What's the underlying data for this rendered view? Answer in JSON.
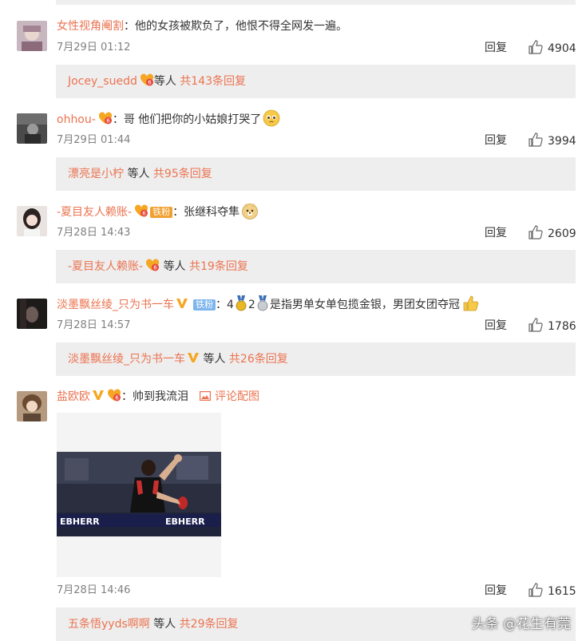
{
  "comments": [
    {
      "username": "女性视角阉割",
      "text": "他的女孩被欺负了，他恨不得全网发一遍。",
      "time": "7月29日 01:12",
      "reply_label": "回复",
      "likes": "4904",
      "sub": {
        "name": "Jocey_suedd",
        "suffix": "等人",
        "count": "共143条回复"
      }
    },
    {
      "username": "ohhou-",
      "text": "哥 他们把你的小姑娘打哭了",
      "time": "7月29日 01:44",
      "reply_label": "回复",
      "likes": "3994",
      "sub": {
        "name": "漂亮是小柠",
        "suffix": "等人",
        "count": "共95条回复"
      }
    },
    {
      "username": "-夏目友人赖账-",
      "fan_tag": "铁粉",
      "text": "张继科夺隼",
      "time": "7月28日 14:43",
      "reply_label": "回复",
      "likes": "2609",
      "sub": {
        "name": "-夏目友人赖账-",
        "suffix": "等人",
        "count": "共19条回复"
      }
    },
    {
      "username": "淡墨飘丝绫_只为书一车",
      "fan_tag": "铁粉",
      "text_a": "4",
      "text_b": "2",
      "text_c": "是指男单女单包揽金银，男团女团夺冠",
      "time": "7月28日 14:57",
      "reply_label": "回复",
      "likes": "1786",
      "sub": {
        "name": "淡墨飘丝绫_只为书一车",
        "suffix": "等人",
        "count": "共26条回复"
      }
    },
    {
      "username": "盐欧欧",
      "text": "帅到我流泪",
      "image_link": "评论配图",
      "time": "7月28日 14:46",
      "reply_label": "回复",
      "likes": "1615",
      "sub": {
        "name": "五条悟yyds啊啊",
        "suffix": "等人",
        "count": "共29条回复"
      }
    }
  ],
  "watermark": "头条 @花生有莞",
  "photo_text": "EBHERR",
  "colors": {
    "accent": "#eb7350",
    "sub_bg": "#eeeeee",
    "meta": "#808080",
    "fan_tag_gold": "#f0a030",
    "fan_tag_blue": "#7cb5ec"
  },
  "icons": [
    "thumbs-up-icon",
    "vip-heart-badge",
    "verified-v-icon",
    "image-icon",
    "medal-icon"
  ]
}
